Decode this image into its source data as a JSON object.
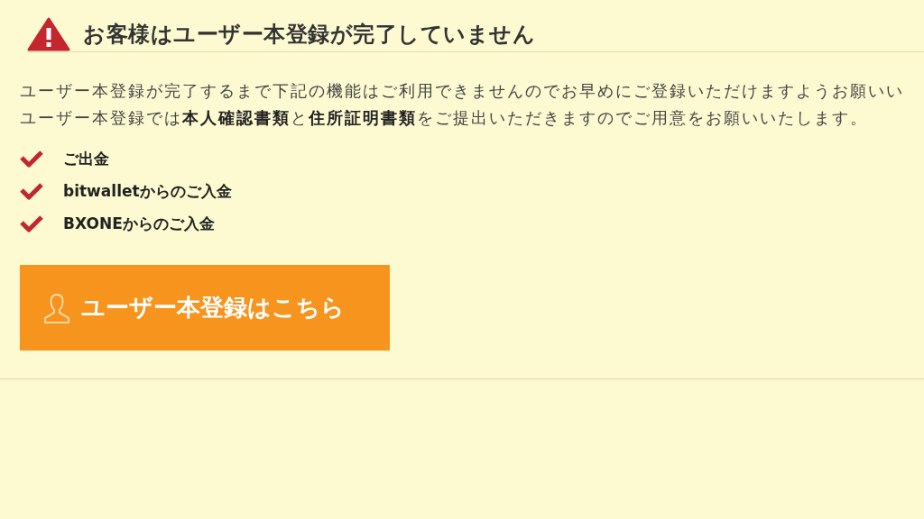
{
  "notice": {
    "title": "お客様はユーザー本登録が完了していません",
    "description": [
      "ユーザー本登録が完了するまで下記の機能はご利用できませんのでお早めにご登録いただけますようお願いい",
      "ユーザー本登録では**本人確認書類**と**住所証明書類**をご提出いただきますのでご用意をお願いいたします。"
    ],
    "restricted_features": [
      "ご出金",
      "bitwalletからのご入金",
      "BXONEからのご入金"
    ],
    "register_button": {
      "label": "ユーザー本登録はこちら"
    }
  }
}
